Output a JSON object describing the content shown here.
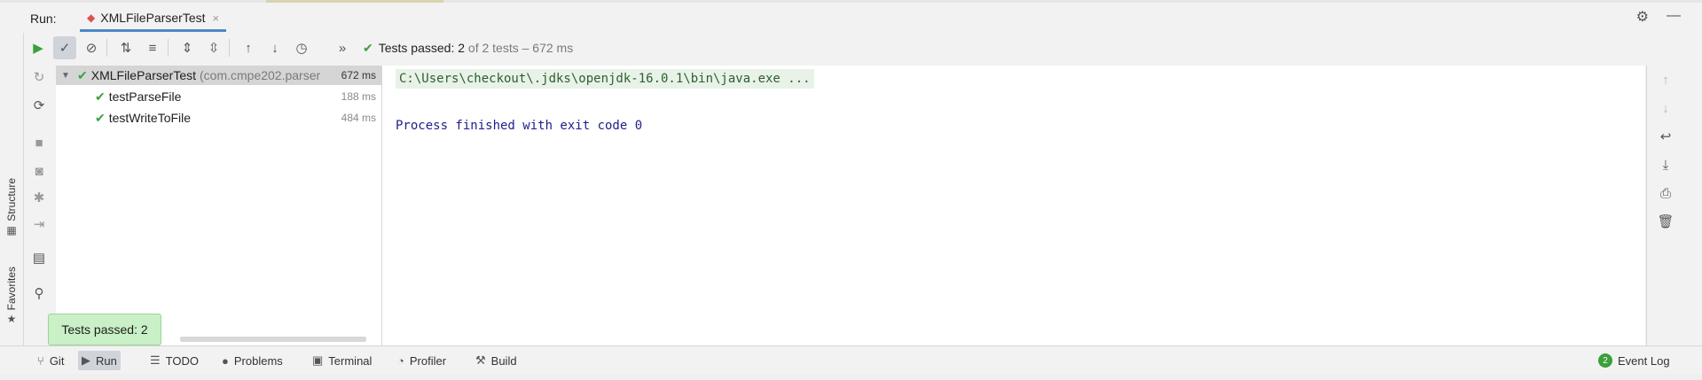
{
  "run": {
    "label": "Run:",
    "tab_title": "XMLFileParserTest",
    "tab_close": "×"
  },
  "toolbar": {
    "status_passed": "Tests passed:",
    "status_count": "2",
    "status_detail": "of 2 tests – 672 ms"
  },
  "tree": {
    "root": {
      "name": "XMLFileParserTest",
      "pkg": "(com.cmpe202.parser",
      "duration": "672 ms"
    },
    "items": [
      {
        "name": "testParseFile",
        "duration": "188 ms"
      },
      {
        "name": "testWriteToFile",
        "duration": "484 ms"
      }
    ]
  },
  "console": {
    "command": "C:\\Users\\checkout\\.jdks\\openjdk-16.0.1\\bin\\java.exe ...",
    "exit": "Process finished with exit code 0"
  },
  "tooltip": "Tests passed: 2",
  "left_strip": {
    "structure": "Structure",
    "favorites": "Favorites"
  },
  "bottom_bar": {
    "git": "Git",
    "run": "Run",
    "todo": "TODO",
    "problems": "Problems",
    "terminal": "Terminal",
    "profiler": "Profiler",
    "build": "Build",
    "event_log": "Event Log",
    "event_count": "2"
  },
  "colors": {
    "accent": "#4a88c7",
    "success": "#3c9f3c",
    "tooltip_bg": "#c9f0c6"
  }
}
